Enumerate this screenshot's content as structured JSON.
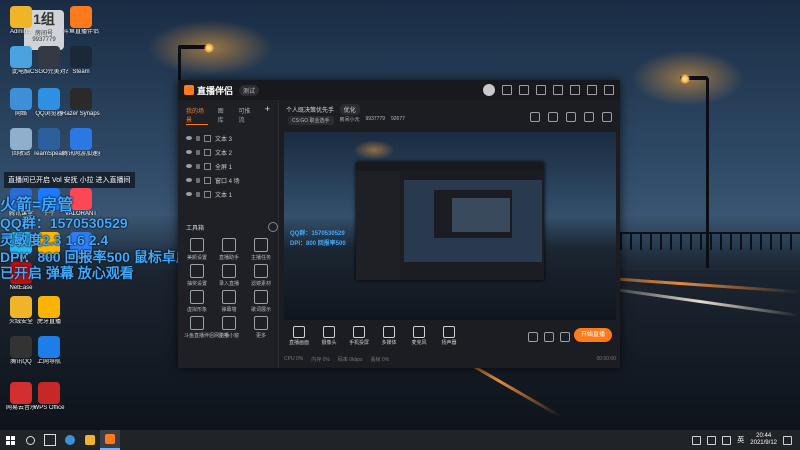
{
  "desktop": {
    "icons": [
      {
        "label": "Admin...",
        "color": "#f0b429"
      },
      {
        "label": "斗鱼直播伴侣",
        "color": "#ff7a1a"
      },
      {
        "label": "此电脑",
        "color": "#4aa3df"
      },
      {
        "label": "CSGO完美对战平台",
        "color": "#333a44"
      },
      {
        "label": "Steam",
        "color": "#1b2838"
      },
      {
        "label": "网络",
        "color": "#3d8fd8"
      },
      {
        "label": "QQ浏览器",
        "color": "#2f8fe0"
      },
      {
        "label": "Razer Synapse",
        "color": "#2a2a2a"
      },
      {
        "label": "回收站",
        "color": "#8fb0cc"
      },
      {
        "label": "TeamSpeak",
        "color": "#2b5f9e"
      },
      {
        "label": "腾讯网游加速器",
        "color": "#2b78e4"
      },
      {
        "label": "腾讯课堂",
        "color": "#2b6cd4"
      },
      {
        "label": "千牛",
        "color": "#1f78ff"
      },
      {
        "label": "VALORANT",
        "color": "#ff4655"
      },
      {
        "label": "TIM",
        "color": "#2bb8f0"
      },
      {
        "label": "酷狗",
        "color": "#ffb800"
      },
      {
        "label": "腾讯会议",
        "color": "#2f7cf6"
      },
      {
        "label": "NetEase",
        "color": "#c20c0c"
      },
      {
        "label": "火绒安全",
        "color": "#f0b429"
      },
      {
        "label": "虎牙直播",
        "color": "#f8b400"
      },
      {
        "label": "腾讯QQ",
        "color": "#333333"
      },
      {
        "label": "上网导航",
        "color": "#1e7ee8"
      },
      {
        "label": "网易云音乐",
        "color": "#d32f2f"
      },
      {
        "label": "WPS Office",
        "color": "#c62828"
      }
    ],
    "badge": {
      "line1": "1组",
      "line2": "房间号",
      "line3": "9937779"
    },
    "overlay": {
      "notice": "直播间已开启 Vol 安抚 小拉 进入直播间",
      "line1": "火箭=房管",
      "line2": "QQ群：1570530529",
      "line3": "灵敏度2.3  1.6  2.4",
      "line4": "DPI：800  回报率500  鼠标卓威EC1-B",
      "line5": "已开启 弹幕 放心观看"
    }
  },
  "app": {
    "name": "直播伴侣",
    "version": "测试",
    "side_tabs": [
      "我的场景",
      "图库",
      "可推流"
    ],
    "scenes": [
      "文本 3",
      "文本 2",
      "全屏 1",
      "窗口 4 场",
      "文本 1"
    ],
    "tools_title": "工具箱",
    "tools": [
      "美颜设置",
      "直播助手",
      "主播任务",
      "抽奖设置",
      "录入直播",
      "滤镜素材",
      "虚拟形象",
      "弹幕墙",
      "歌词展示",
      "斗鱼直播伴侣网助手",
      "主播小窗",
      "更多"
    ],
    "header_title": "个人既决策优先手",
    "header_tag": "优化",
    "meta": {
      "channel": "CS:GO 职业选手",
      "room_label": "房间小元",
      "room_id": "9937779",
      "heat": "92677"
    },
    "controls": [
      "直播画面",
      "摄像头",
      "手机投屏",
      "多媒体",
      "麦克风",
      "扬声器"
    ],
    "start_label": "开始直播",
    "status": [
      "CPU 0%",
      "内存 0%",
      "码率 0kbps",
      "丢帧 0%",
      "00:00:00"
    ],
    "preview_overlay": [
      "QQ群：1570530529",
      "DPI：800  回报率500"
    ]
  },
  "taskbar": {
    "time": "20:44",
    "date": "2021/9/12",
    "lang": "英"
  }
}
